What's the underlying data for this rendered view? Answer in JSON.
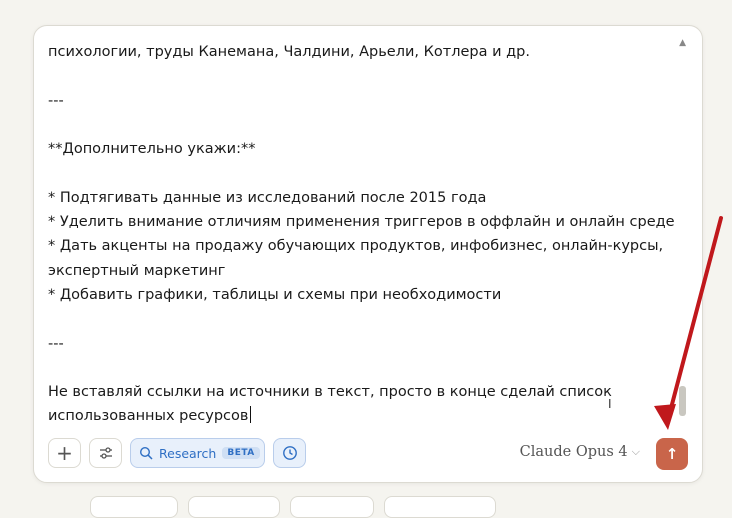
{
  "composer": {
    "lines": [
      "психологии, труды Канемана, Чалдини, Арьели, Котлера и др.",
      "",
      "---",
      "",
      "**Дополнительно укажи:**",
      "",
      "* Подтягивать данные из исследований после 2015 года",
      "* Уделить внимание отличиям применения триггеров в оффлайн и онлайн среде",
      "* Дать акценты на продажу обучающих продуктов, инфобизнес, онлайн-курсы,",
      "экспертный маркетинг",
      "* Добавить графики, таблицы и схемы при необходимости",
      "",
      "---",
      "",
      "Не вставляй ссылки на источники в текст, просто в конце сделай список",
      "использованных ресурсов"
    ]
  },
  "toolbar": {
    "plus_icon": "+",
    "research_label": "Research",
    "beta_label": "BETA",
    "model_label": "Claude Opus 4",
    "chevron": "⌵",
    "send_icon": "↑"
  },
  "icons": {
    "plus": "plus-icon",
    "tools": "sliders-icon",
    "research": "search-icon",
    "clock": "clock-icon",
    "send": "arrow-up-icon"
  },
  "colors": {
    "send": "#c9654a",
    "research_bg": "#e8f0fb",
    "research_text": "#2f6fc4",
    "annotation_arrow": "#c0181c"
  }
}
